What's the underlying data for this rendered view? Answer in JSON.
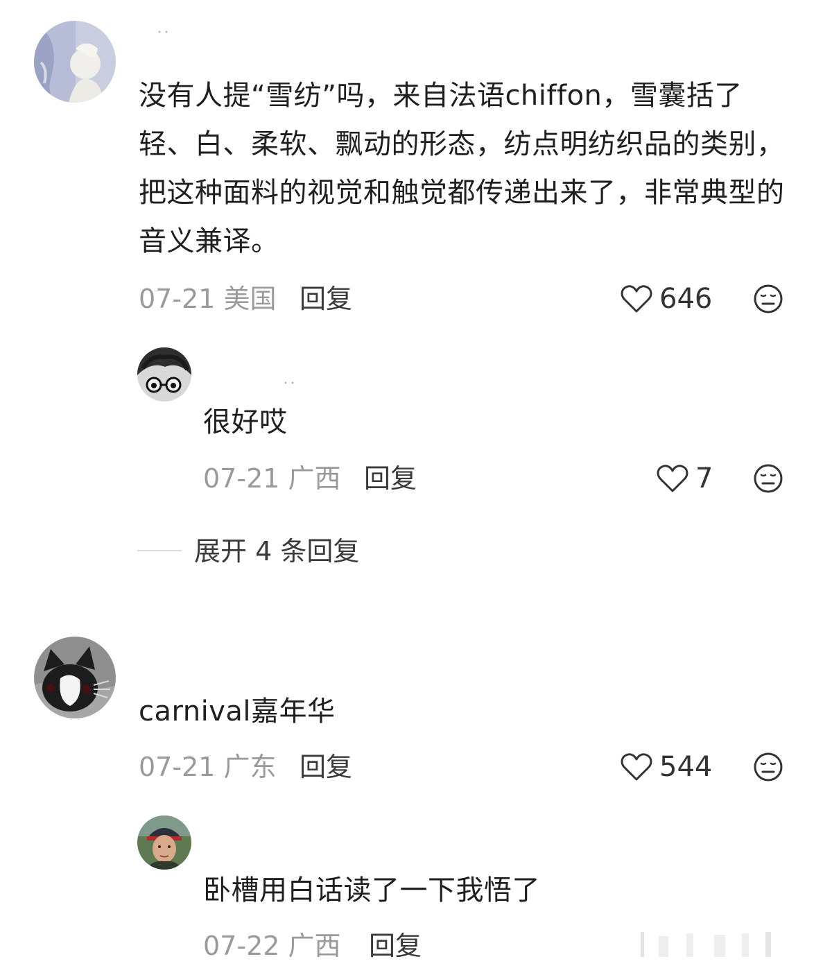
{
  "comments": [
    {
      "text": "没有人提“雪纺”吗，来自法语chiffon，雪囊括了轻、白、柔软、飘动的形态，纺点明纺织品的类别，把这种面料的视觉和触觉都传递出来了，非常典型的音义兼译。",
      "date_location": "07-21 美国",
      "reply_label": "回复",
      "likes": "646",
      "replies": [
        {
          "text": "很好哎",
          "date_location": "07-21 广西",
          "reply_label": "回复",
          "likes": "7"
        }
      ],
      "expand_label": "展开 4 条回复"
    },
    {
      "text": "carnival嘉年华",
      "date_location": "07-21 广东",
      "reply_label": "回复",
      "likes": "544",
      "replies": [
        {
          "text": "卧槽用白话读了一下我悟了",
          "date_location": "07-22 广西",
          "reply_label": "回复"
        }
      ]
    }
  ],
  "icons": {
    "like": "heart-outline-icon",
    "dislike": "neutral-face-icon"
  },
  "colors": {
    "meta_text": "#9a9a9a",
    "body_text": "#1f1f1f",
    "icon_stroke": "#333333"
  }
}
